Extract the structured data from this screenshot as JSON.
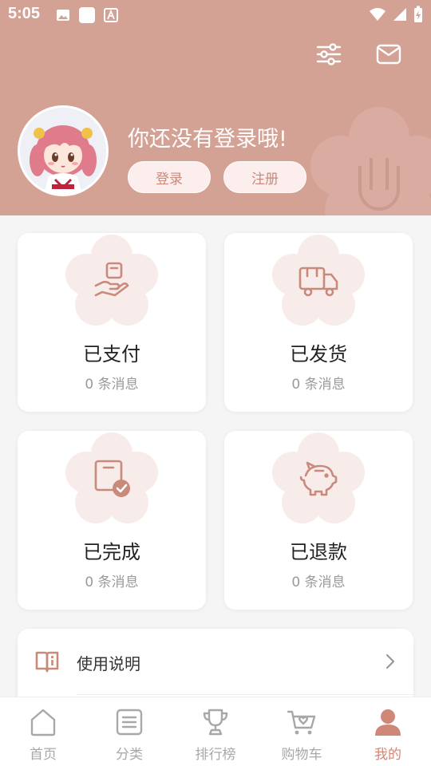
{
  "status_bar": {
    "time": "5:05"
  },
  "header": {
    "welcome": "你还没有登录哦!",
    "login_label": "登录",
    "register_label": "注册"
  },
  "orders": [
    {
      "title": "已支付",
      "sub": "0 条消息",
      "icon": "hand-box-icon"
    },
    {
      "title": "已发货",
      "sub": "0 条消息",
      "icon": "truck-icon"
    },
    {
      "title": "已完成",
      "sub": "0 条消息",
      "icon": "box-check-icon"
    },
    {
      "title": "已退款",
      "sub": "0 条消息",
      "icon": "piggy-bank-icon"
    }
  ],
  "menu": [
    {
      "label": "使用说明",
      "icon": "manual-book-icon"
    }
  ],
  "tabs": [
    {
      "label": "首页",
      "icon": "home-icon"
    },
    {
      "label": "分类",
      "icon": "list-icon"
    },
    {
      "label": "排行榜",
      "icon": "trophy-icon"
    },
    {
      "label": "购物车",
      "icon": "cart-icon"
    },
    {
      "label": "我的",
      "icon": "person-icon",
      "active": true
    }
  ],
  "colors": {
    "header_bg": "#d4a195",
    "accent": "#cf8878",
    "icon_stroke": "#c98a7b",
    "blossom": "#f7ecea"
  }
}
